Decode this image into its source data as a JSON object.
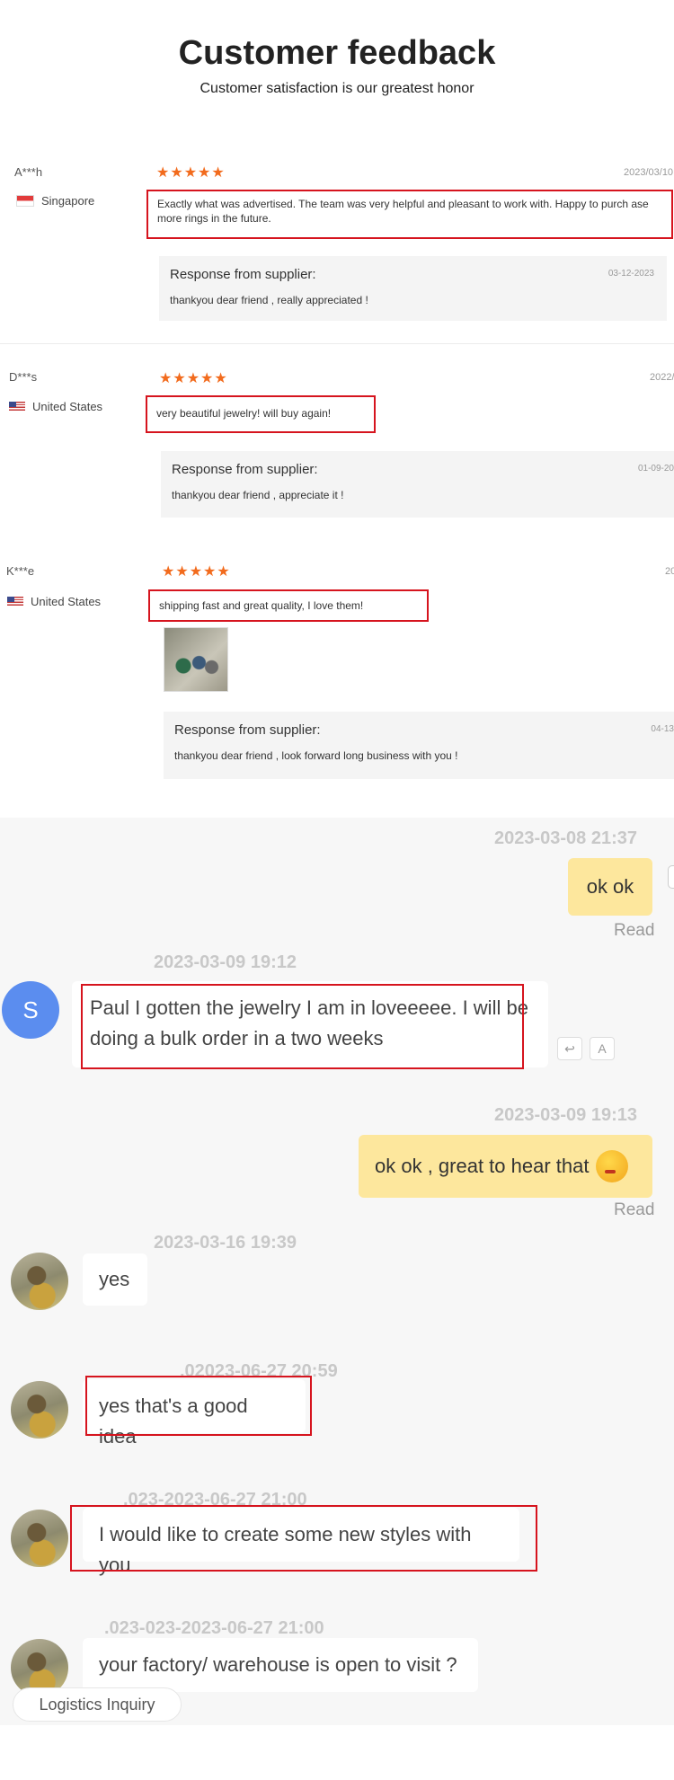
{
  "header": {
    "title": "Customer feedback",
    "subtitle": "Customer satisfaction is our greatest honor"
  },
  "reviews": [
    {
      "name": "A***h",
      "country": "Singapore",
      "rating": 5,
      "stars": "★★★★★",
      "date": "2023/03/10",
      "comment": "Exactly what was advertised. The team was very helpful and pleasant to work with. Happy to purch ase more rings in the future.",
      "response_title": "Response from supplier:",
      "response_date": "03-12-2023",
      "response_text": "thankyou dear friend , really appreciated !"
    },
    {
      "name": "D***s",
      "country": "United States",
      "rating": 5,
      "stars": "★★★★★",
      "date": "2022/",
      "comment": "very beautiful jewelry! will buy again!",
      "response_title": "Response from supplier:",
      "response_date": "01-09-20",
      "response_text": "thankyou dear friend , appreciate it !"
    },
    {
      "name": "K***e",
      "country": "United States",
      "rating": 5,
      "stars": "★★★★★",
      "date": "20",
      "comment": "shipping fast and great quality, I love them!",
      "response_title": "Response from supplier:",
      "response_date": "04-13",
      "response_text": "thankyou dear friend , look forward long business with you !"
    }
  ],
  "chat": {
    "messages": [
      {
        "time": "2023-03-08 21:37",
        "text": "ok ok",
        "status": "Read"
      },
      {
        "time": "2023-03-09 19:12",
        "avatar": "S",
        "text": "Paul I gotten the jewelry I am in loveeeee. I will be doing a bulk order in a two weeks"
      },
      {
        "time": "2023-03-09 19:13",
        "text": "ok ok , great to hear that",
        "status": "Read"
      },
      {
        "time": "2023-03-16 19:39",
        "text": "yes"
      },
      {
        "time": ".02023-06-27 20:59",
        "text": "yes that's a good idea"
      },
      {
        "time": ".023-2023-06-27 21:00",
        "text": "I would like to create some new styles with you"
      },
      {
        "time": ".023-023-2023-06-27 21:00",
        "text": "your factory/ warehouse is open to visit ?"
      }
    ],
    "logistics_chip": "Logistics Inquiry",
    "icons": {
      "reply": "reply-icon",
      "translate": "translate-icon",
      "emoji": "emoji-icon"
    }
  },
  "colors": {
    "accent_red": "#d6141e",
    "star_orange": "#f26b1d",
    "bubble_yellow": "#fde79d",
    "avatar_blue": "#5b8def"
  }
}
